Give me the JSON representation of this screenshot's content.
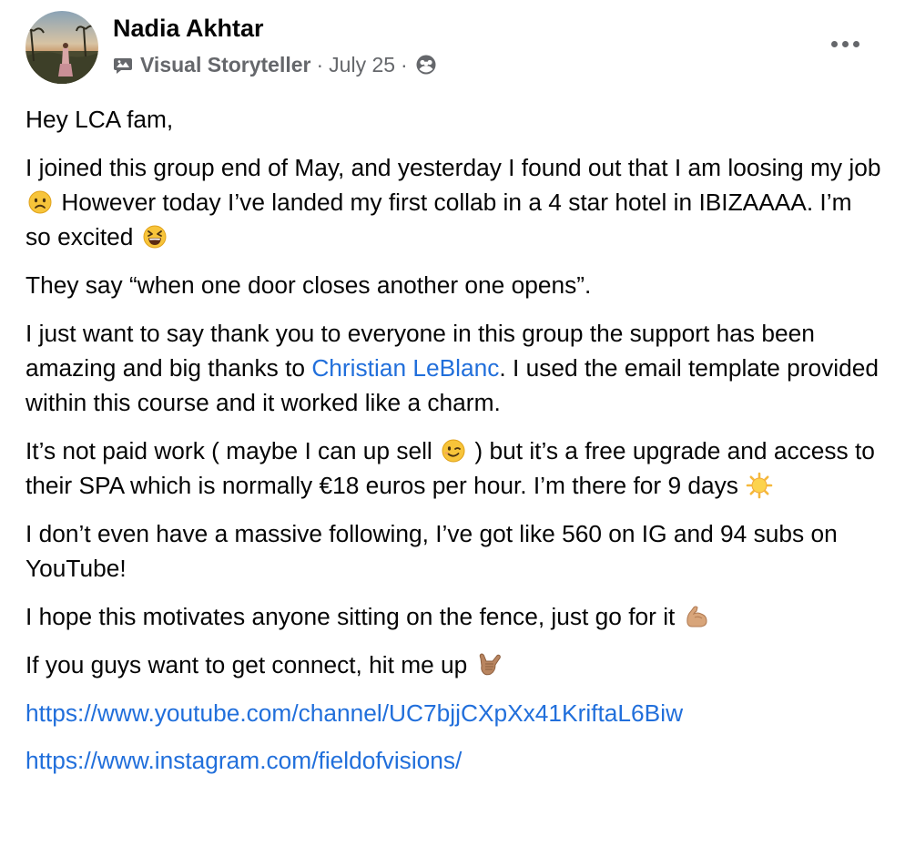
{
  "post": {
    "author": {
      "name": "Nadia Akhtar",
      "badge": "Visual Storyteller"
    },
    "date": "July 25",
    "separator": "·",
    "paragraphs": {
      "greeting": "Hey LCA fam,",
      "p1": {
        "a": "I joined this group end of May, and yesterday I found out that I am loosing my job",
        "b": "However today I’ve landed my first collab in a 4 star hotel in IBIZAAAA. I’m so excited"
      },
      "p2": "They say “when one door closes another one opens”.",
      "p3": {
        "a": "I just want to say thank you to everyone in this group the support has been amazing and big thanks to",
        "mention": "Christian LeBlanc",
        "b": ". I used the email template provided within this course and it worked like a charm."
      },
      "p4": {
        "a": "It’s not paid work ( maybe I can up sell",
        "b": ") but it’s a free upgrade and access to their SPA which is normally €18 euros per hour. I’m there for 9 days"
      },
      "p5": "I don’t even have a massive following, I’ve got like 560 on IG and 94 subs on YouTube!",
      "p6": "I hope this motivates anyone sitting on the fence, just go for it",
      "p7": "If you guys want to get connect, hit me up",
      "links": {
        "youtube": "https://www.youtube.com/channel/UC7bjjCXpXx41KriftaL6Biw",
        "instagram": "https://www.instagram.com/fieldofvisions/"
      }
    },
    "icons": {
      "badge": "visual-storyteller-badge-icon",
      "privacy": "group-privacy-icon",
      "more": "more-options-icon",
      "emoji_sad": "frowning-face-emoji",
      "emoji_laugh": "grinning-squinting-face-emoji",
      "emoji_wink": "winking-face-emoji",
      "emoji_sun": "sun-emoji",
      "emoji_muscle": "flexed-biceps-emoji",
      "emoji_callme": "call-me-hand-emoji"
    },
    "colors": {
      "text": "#050505",
      "secondary": "#65676b",
      "link": "#216fdb"
    }
  }
}
